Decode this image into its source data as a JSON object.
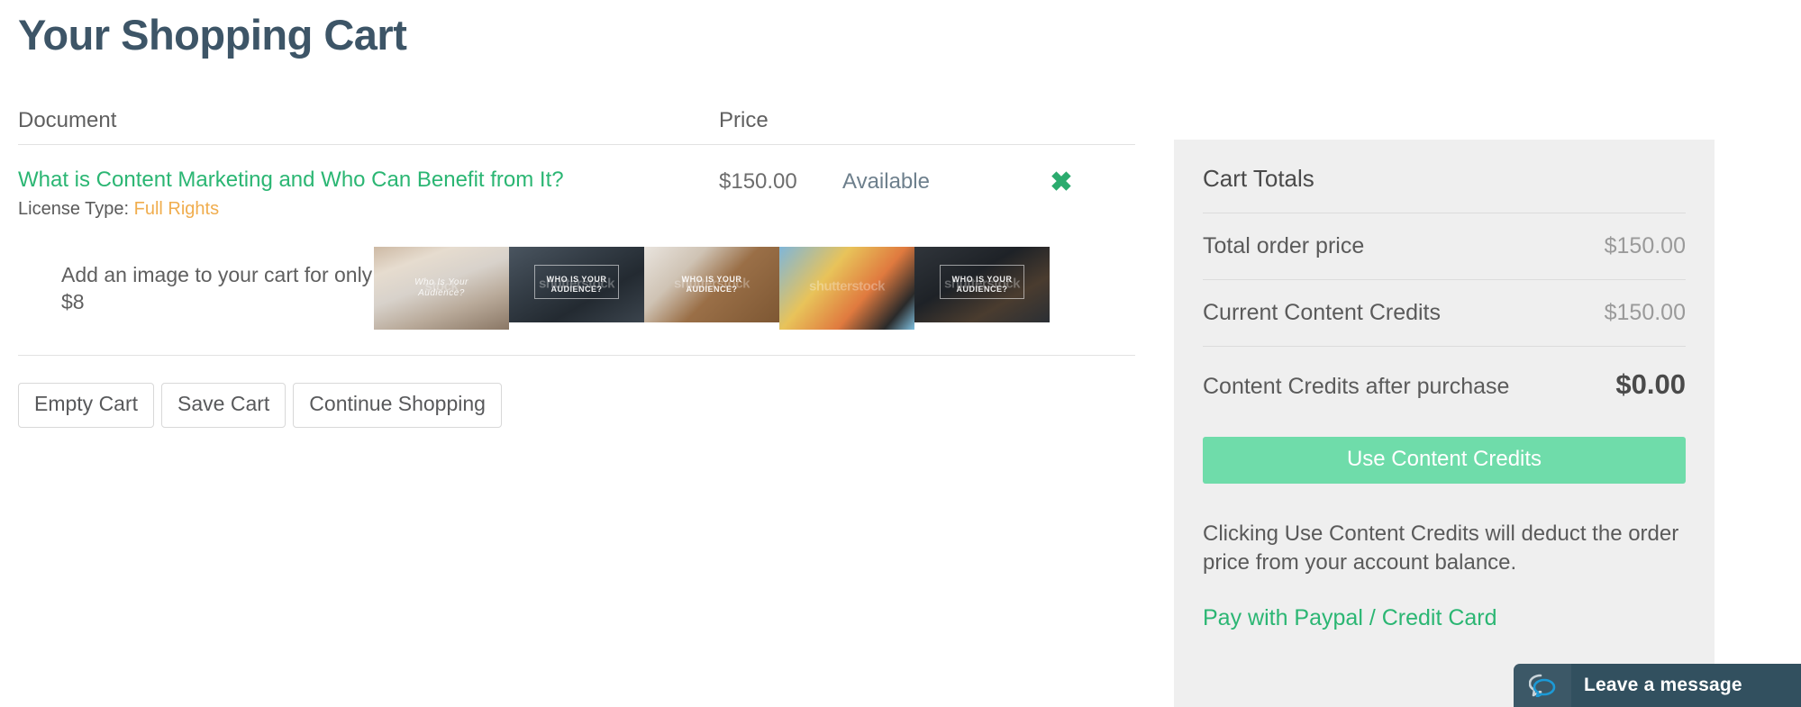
{
  "page": {
    "title": "Your Shopping Cart"
  },
  "table": {
    "headers": {
      "document": "Document",
      "price": "Price"
    },
    "rows": [
      {
        "title": "What is Content Marketing and Who Can Benefit from It?",
        "license_label": "License Type:",
        "license_value": "Full Rights",
        "price": "$150.00",
        "status": "Available",
        "remove_glyph": "✖"
      }
    ]
  },
  "upsell": {
    "text": "Add an image to your cart for only $8",
    "thumbnails": [
      {
        "caption": "Who Is Your Audience?",
        "watermark": "stock"
      },
      {
        "caption": "WHO IS YOUR AUDIENCE?",
        "watermark": "shutterstock"
      },
      {
        "caption": "WHO IS YOUR AUDIENCE?",
        "watermark": "shutterstock"
      },
      {
        "caption": "",
        "watermark": "shutterstock"
      },
      {
        "caption": "WHO IS YOUR AUDIENCE?",
        "watermark": "shutterstock"
      }
    ]
  },
  "actions": {
    "empty_cart": "Empty Cart",
    "save_cart": "Save Cart",
    "continue_shopping": "Continue Shopping"
  },
  "cart_totals": {
    "title": "Cart Totals",
    "rows": [
      {
        "label": "Total order price",
        "value": "$150.00"
      },
      {
        "label": "Current Content Credits",
        "value": "$150.00"
      },
      {
        "label": "Content Credits after purchase",
        "value": "$0.00"
      }
    ],
    "use_credits_button": "Use Content Credits",
    "note": "Clicking Use Content Credits will deduct the order price from your account balance.",
    "paypal_link": "Pay with Paypal / Credit Card"
  },
  "chat": {
    "label": "Leave a message",
    "icon": "chat-bubble-icon"
  },
  "colors": {
    "title": "#3d5567",
    "link_green": "#2bb673",
    "license_amber": "#f0ad4e",
    "cta_green": "#6fdcaa",
    "panel_bg": "#efefef",
    "chat_bg": "#32505f"
  }
}
